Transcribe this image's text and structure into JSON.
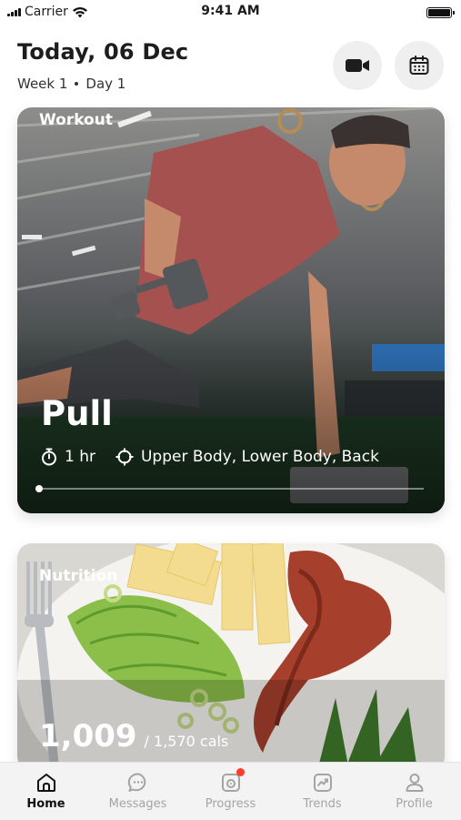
{
  "status_bar": {
    "carrier": "Carrier",
    "time": "9:41 AM"
  },
  "header": {
    "title": "Today, 06 Dec",
    "week": "Week 1",
    "day": "Day 1",
    "video_icon": "video-camera-icon",
    "calendar_icon": "calendar-icon"
  },
  "workout": {
    "label": "Workout",
    "name": "Pull",
    "duration": "1 hr",
    "focus": "Upper Body, Lower Body, Back",
    "progress": 0.0,
    "duration_icon": "stopwatch-icon",
    "focus_icon": "crosshair-icon"
  },
  "nutrition": {
    "label": "Nutrition",
    "calories_consumed": "1,009",
    "calories_total": "/ 1,570 cals"
  },
  "nav": {
    "items": [
      {
        "label": "Home",
        "icon": "home-icon",
        "active": true
      },
      {
        "label": "Messages",
        "icon": "chat-bubble-icon",
        "active": false
      },
      {
        "label": "Progress",
        "icon": "camera-progress-icon",
        "active": false,
        "badge": true
      },
      {
        "label": "Trends",
        "icon": "trend-chart-icon",
        "active": false
      },
      {
        "label": "Profile",
        "icon": "person-icon",
        "active": false
      }
    ]
  },
  "colors": {
    "badge": "#ff3b30",
    "active_nav": "#111111",
    "inactive_nav": "#a4a4a4"
  }
}
